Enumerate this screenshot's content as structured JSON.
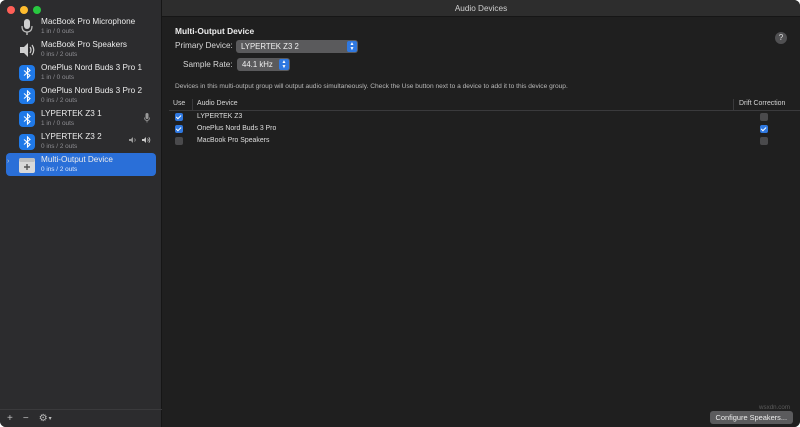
{
  "window": {
    "title": "Audio Devices"
  },
  "sidebar": {
    "devices": [
      {
        "name": "MacBook Pro Microphone",
        "sub": "1 in / 0 outs",
        "icon": "microphone-icon"
      },
      {
        "name": "MacBook Pro Speakers",
        "sub": "0 ins / 2 outs",
        "icon": "speaker-icon"
      },
      {
        "name": "OnePlus Nord Buds 3 Pro 1",
        "sub": "1 in / 0 outs",
        "icon": "bluetooth-icon"
      },
      {
        "name": "OnePlus Nord Buds 3 Pro 2",
        "sub": "0 ins / 2 outs",
        "icon": "bluetooth-icon"
      },
      {
        "name": "LYPERTEK Z3 1",
        "sub": "1 in / 0 outs",
        "icon": "bluetooth-icon"
      },
      {
        "name": "LYPERTEK Z3 2",
        "sub": "0 ins / 2 outs",
        "icon": "bluetooth-icon"
      },
      {
        "name": "Multi-Output Device",
        "sub": "0 ins / 2 outs",
        "icon": "multi-output-icon"
      }
    ],
    "bottom": {
      "add": "+",
      "remove": "−",
      "gear": "⚙",
      "gear_caret": "▾"
    }
  },
  "main": {
    "section_title": "Multi-Output Device",
    "primary_device_label": "Primary Device:",
    "primary_device_value": "LYPERTEK Z3 2",
    "sample_rate_label": "Sample Rate:",
    "sample_rate_value": "44.1 kHz",
    "help": "?",
    "description": "Devices in this multi-output group will output audio simultaneously. Check the Use button next to a device to add it to this device group.",
    "table": {
      "columns": [
        "Use",
        "Audio Device",
        "Drift Correction"
      ],
      "rows": [
        {
          "use": true,
          "device": "LYPERTEK Z3",
          "drift": false
        },
        {
          "use": true,
          "device": "OnePlus Nord Buds 3 Pro",
          "drift": true
        },
        {
          "use": false,
          "device": "MacBook Pro Speakers",
          "drift": false
        }
      ]
    },
    "configure_button": "Configure Speakers...",
    "watermark": "wsxdn.com"
  },
  "colors": {
    "accent": "#2f78e0",
    "selection": "#2a6fd8",
    "bluetooth_badge": "#1f79e8",
    "traffic_close": "#ff5f57",
    "traffic_min": "#febc2e",
    "traffic_max": "#28c840"
  }
}
